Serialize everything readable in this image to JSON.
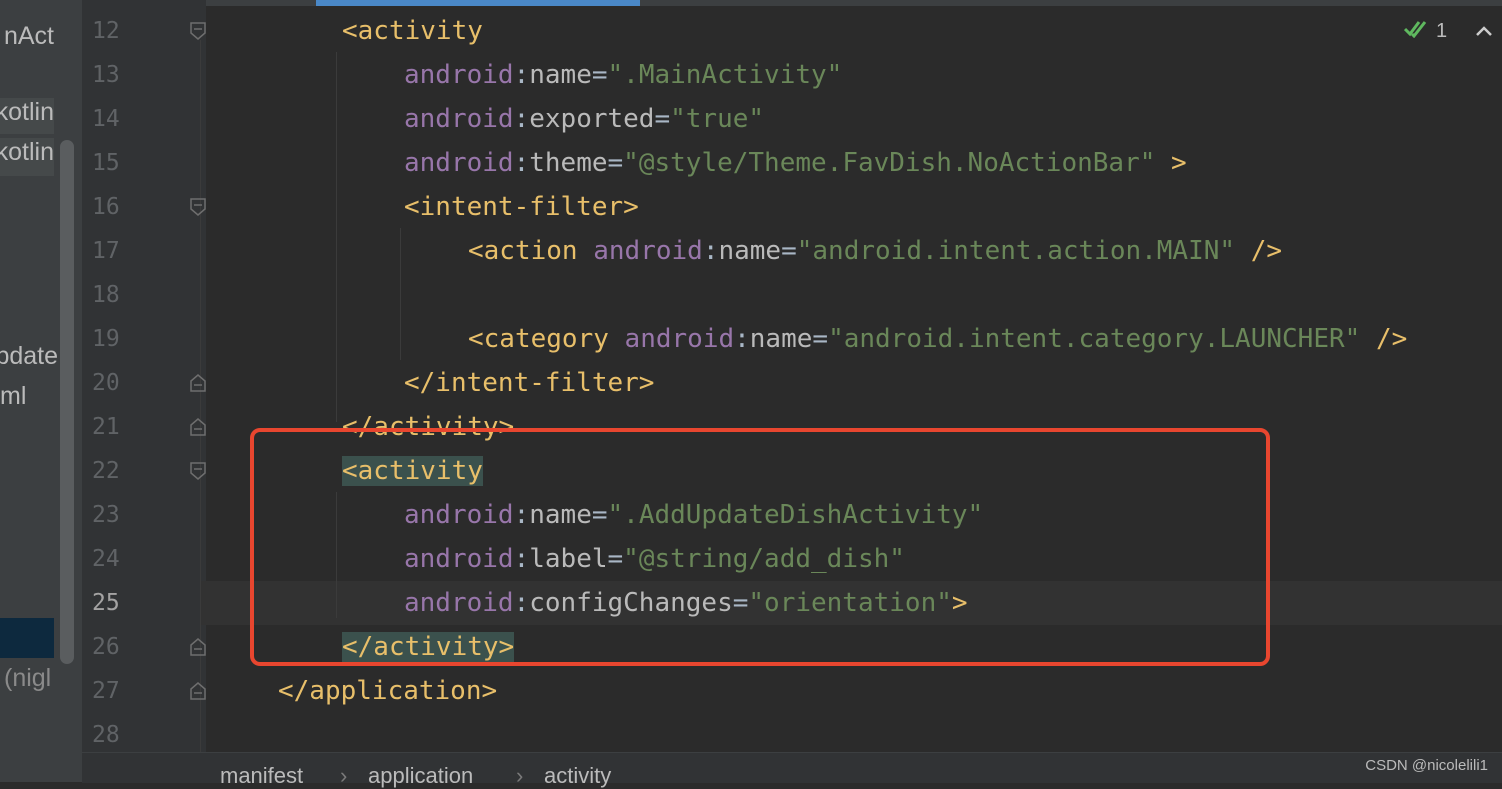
{
  "project_panel": {
    "items": [
      "nAct",
      "kotlin",
      "kotlin",
      "pdate",
      "ml",
      "(nigl"
    ]
  },
  "editor": {
    "inspection_count": "1",
    "inspection_icon": "double-check-icon",
    "collapse_icon": "chevron-up-icon",
    "current_line": 25,
    "lines": [
      {
        "num": "12",
        "tokens": [
          [
            "t",
            "<activity"
          ]
        ]
      },
      {
        "num": "13",
        "tokens": [
          [
            "ns",
            "android"
          ],
          [
            "p",
            ":"
          ],
          [
            "at",
            "name"
          ],
          [
            "p",
            "="
          ],
          [
            "v",
            "\".MainActivity\""
          ]
        ]
      },
      {
        "num": "14",
        "tokens": [
          [
            "ns",
            "android"
          ],
          [
            "p",
            ":"
          ],
          [
            "at",
            "exported"
          ],
          [
            "p",
            "="
          ],
          [
            "v",
            "\"true\""
          ]
        ]
      },
      {
        "num": "15",
        "tokens": [
          [
            "ns",
            "android"
          ],
          [
            "p",
            ":"
          ],
          [
            "at",
            "theme"
          ],
          [
            "p",
            "="
          ],
          [
            "v",
            "\"@style/Theme.FavDish.NoActionBar\""
          ],
          [
            "p",
            " "
          ],
          [
            "t",
            ">"
          ]
        ]
      },
      {
        "num": "16",
        "tokens": [
          [
            "t",
            "<intent-filter>"
          ]
        ]
      },
      {
        "num": "17",
        "tokens": [
          [
            "t",
            "<action "
          ],
          [
            "ns",
            "android"
          ],
          [
            "p",
            ":"
          ],
          [
            "at",
            "name"
          ],
          [
            "p",
            "="
          ],
          [
            "v",
            "\"android.intent.action.MAIN\""
          ],
          [
            "p",
            " "
          ],
          [
            "t",
            "/>"
          ]
        ]
      },
      {
        "num": "18",
        "tokens": []
      },
      {
        "num": "19",
        "tokens": [
          [
            "t",
            "<category "
          ],
          [
            "ns",
            "android"
          ],
          [
            "p",
            ":"
          ],
          [
            "at",
            "name"
          ],
          [
            "p",
            "="
          ],
          [
            "v",
            "\"android.intent.category.LAUNCHER\""
          ],
          [
            "p",
            " "
          ],
          [
            "t",
            "/>"
          ]
        ]
      },
      {
        "num": "20",
        "tokens": [
          [
            "t",
            "</intent-filter>"
          ]
        ]
      },
      {
        "num": "21",
        "tokens": [
          [
            "t",
            "</activity>"
          ]
        ]
      },
      {
        "num": "22",
        "tokens": [
          [
            "t",
            "<activity"
          ]
        ]
      },
      {
        "num": "23",
        "tokens": [
          [
            "ns",
            "android"
          ],
          [
            "p",
            ":"
          ],
          [
            "at",
            "name"
          ],
          [
            "p",
            "="
          ],
          [
            "v",
            "\".AddUpdateDishActivity\""
          ]
        ]
      },
      {
        "num": "24",
        "tokens": [
          [
            "ns",
            "android"
          ],
          [
            "p",
            ":"
          ],
          [
            "at",
            "label"
          ],
          [
            "p",
            "="
          ],
          [
            "v",
            "\"@string/add_dish\""
          ]
        ]
      },
      {
        "num": "25",
        "tokens": [
          [
            "ns",
            "android"
          ],
          [
            "p",
            ":"
          ],
          [
            "at",
            "configChanges"
          ],
          [
            "p",
            "="
          ],
          [
            "v",
            "\"orientation\""
          ],
          [
            "t",
            ">"
          ]
        ]
      },
      {
        "num": "26",
        "tokens": [
          [
            "t",
            "</activity>"
          ]
        ]
      },
      {
        "num": "27",
        "tokens": [
          [
            "t",
            "</application>"
          ]
        ]
      },
      {
        "num": "28",
        "tokens": []
      }
    ]
  },
  "breadcrumb": {
    "items": [
      "manifest",
      "application",
      "activity"
    ]
  },
  "watermark": "CSDN @nicolelili1",
  "colors": {
    "background": "#2b2b2b",
    "tag": "#e8bf6a",
    "namespace": "#9876aa",
    "value": "#6a8759",
    "annotation": "#e8462f"
  }
}
